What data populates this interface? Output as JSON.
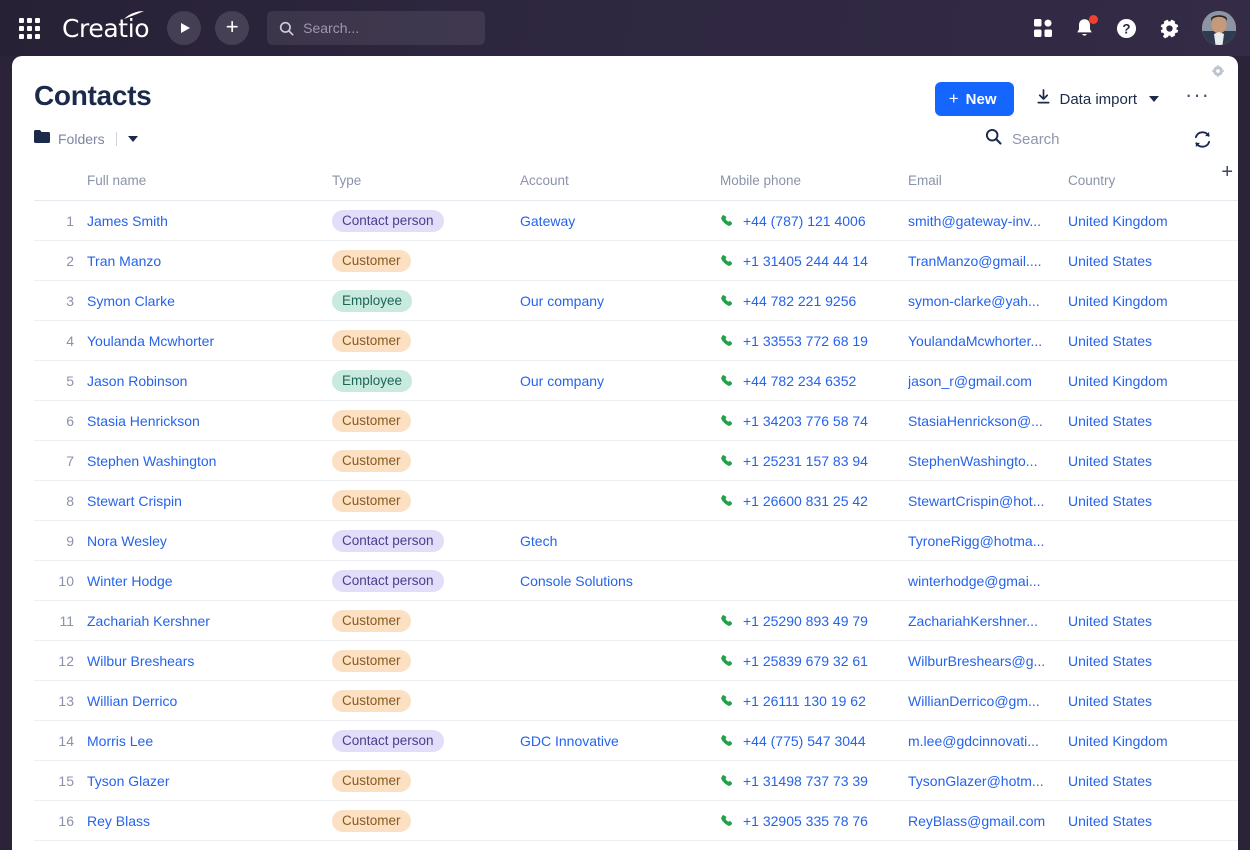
{
  "topbar": {
    "apps_icon": "apps-grid-icon",
    "brand": "Creatio",
    "play_icon": "play-icon",
    "add_icon": "plus-icon",
    "search_placeholder": "Search...",
    "search_value": "",
    "icons": [
      {
        "name": "dashboard-icon",
        "badge": false
      },
      {
        "name": "notifications-bell-icon",
        "badge": true
      },
      {
        "name": "help-icon",
        "badge": false
      },
      {
        "name": "settings-gear-icon",
        "badge": false
      }
    ],
    "avatar_name": "user-avatar"
  },
  "page": {
    "title": "Contacts",
    "new_button": "New",
    "new_plus": "+",
    "data_import": "Data import",
    "more_menu": "···",
    "card_settings_icon": "gear-icon"
  },
  "toolbar": {
    "folders_label": "Folders",
    "search_placeholder": "Search",
    "search_value": "",
    "refresh_icon": "refresh-icon",
    "add_column_icon": "plus-icon",
    "column_menu_icon": "vertical-dots-icon"
  },
  "table": {
    "columns": [
      "Full name",
      "Type",
      "Account",
      "Mobile phone",
      "Email",
      "Country"
    ],
    "rows": [
      {
        "n": "1",
        "name": "James Smith",
        "type": "Contact person",
        "type_class": "contact",
        "account": "Gateway",
        "phone": "+44 (787) 121 4006",
        "email": "smith@gateway-inv...",
        "country": "United Kingdom"
      },
      {
        "n": "2",
        "name": "Tran Manzo",
        "type": "Customer",
        "type_class": "customer",
        "account": "",
        "phone": "+1 31405 244 44 14",
        "email": "TranManzo@gmail....",
        "country": "United States"
      },
      {
        "n": "3",
        "name": "Symon Clarke",
        "type": "Employee",
        "type_class": "employee",
        "account": "Our company",
        "phone": "+44 782 221 9256",
        "email": "symon-clarke@yah...",
        "country": "United Kingdom"
      },
      {
        "n": "4",
        "name": "Youlanda Mcwhorter",
        "type": "Customer",
        "type_class": "customer",
        "account": "",
        "phone": "+1 33553 772 68 19",
        "email": "YoulandaMcwhorter...",
        "country": "United States"
      },
      {
        "n": "5",
        "name": "Jason Robinson",
        "type": "Employee",
        "type_class": "employee",
        "account": "Our company",
        "phone": "+44 782 234 6352",
        "email": "jason_r@gmail.com",
        "country": "United Kingdom"
      },
      {
        "n": "6",
        "name": "Stasia Henrickson",
        "type": "Customer",
        "type_class": "customer",
        "account": "",
        "phone": "+1 34203 776 58 74",
        "email": "StasiaHenrickson@...",
        "country": "United States"
      },
      {
        "n": "7",
        "name": "Stephen Washington",
        "type": "Customer",
        "type_class": "customer",
        "account": "",
        "phone": "+1 25231 157 83 94",
        "email": "StephenWashingto...",
        "country": "United States"
      },
      {
        "n": "8",
        "name": "Stewart Crispin",
        "type": "Customer",
        "type_class": "customer",
        "account": "",
        "phone": "+1 26600 831 25 42",
        "email": "StewartCrispin@hot...",
        "country": "United States"
      },
      {
        "n": "9",
        "name": "Nora Wesley",
        "type": "Contact person",
        "type_class": "contact",
        "account": "Gtech",
        "phone": "",
        "email": "TyroneRigg@hotma...",
        "country": ""
      },
      {
        "n": "10",
        "name": "Winter Hodge",
        "type": "Contact person",
        "type_class": "contact",
        "account": "Console Solutions",
        "phone": "",
        "email": "winterhodge@gmai...",
        "country": ""
      },
      {
        "n": "11",
        "name": "Zachariah Kershner",
        "type": "Customer",
        "type_class": "customer",
        "account": "",
        "phone": "+1 25290 893 49 79",
        "email": "ZachariahKershner...",
        "country": "United States"
      },
      {
        "n": "12",
        "name": "Wilbur Breshears",
        "type": "Customer",
        "type_class": "customer",
        "account": "",
        "phone": "+1 25839 679 32 61",
        "email": "WilburBreshears@g...",
        "country": "United States"
      },
      {
        "n": "13",
        "name": "Willian Derrico",
        "type": "Customer",
        "type_class": "customer",
        "account": "",
        "phone": "+1 26111 130 19 62",
        "email": "WillianDerrico@gm...",
        "country": "United States"
      },
      {
        "n": "14",
        "name": "Morris Lee",
        "type": "Contact person",
        "type_class": "contact",
        "account": "GDC Innovative",
        "phone": "+44 (775) 547 3044",
        "email": "m.lee@gdcinnovati...",
        "country": "United Kingdom"
      },
      {
        "n": "15",
        "name": "Tyson Glazer",
        "type": "Customer",
        "type_class": "customer",
        "account": "",
        "phone": "+1 31498 737 73 39",
        "email": "TysonGlazer@hotm...",
        "country": "United States"
      },
      {
        "n": "16",
        "name": "Rey Blass",
        "type": "Customer",
        "type_class": "customer",
        "account": "",
        "phone": "+1 32905 335 78 76",
        "email": "ReyBlass@gmail.com",
        "country": "United States"
      }
    ]
  },
  "colors": {
    "accent_blue": "#1565ff",
    "link_blue": "#2563eb",
    "title_navy": "#1b2a4b",
    "header_bg": "#2e2740",
    "phone_green": "#24a148",
    "badge_red": "#f1402d",
    "pill_contact_bg": "#e2ddf9",
    "pill_customer_bg": "#fbe0c4",
    "pill_employee_bg": "#c8eadf"
  }
}
